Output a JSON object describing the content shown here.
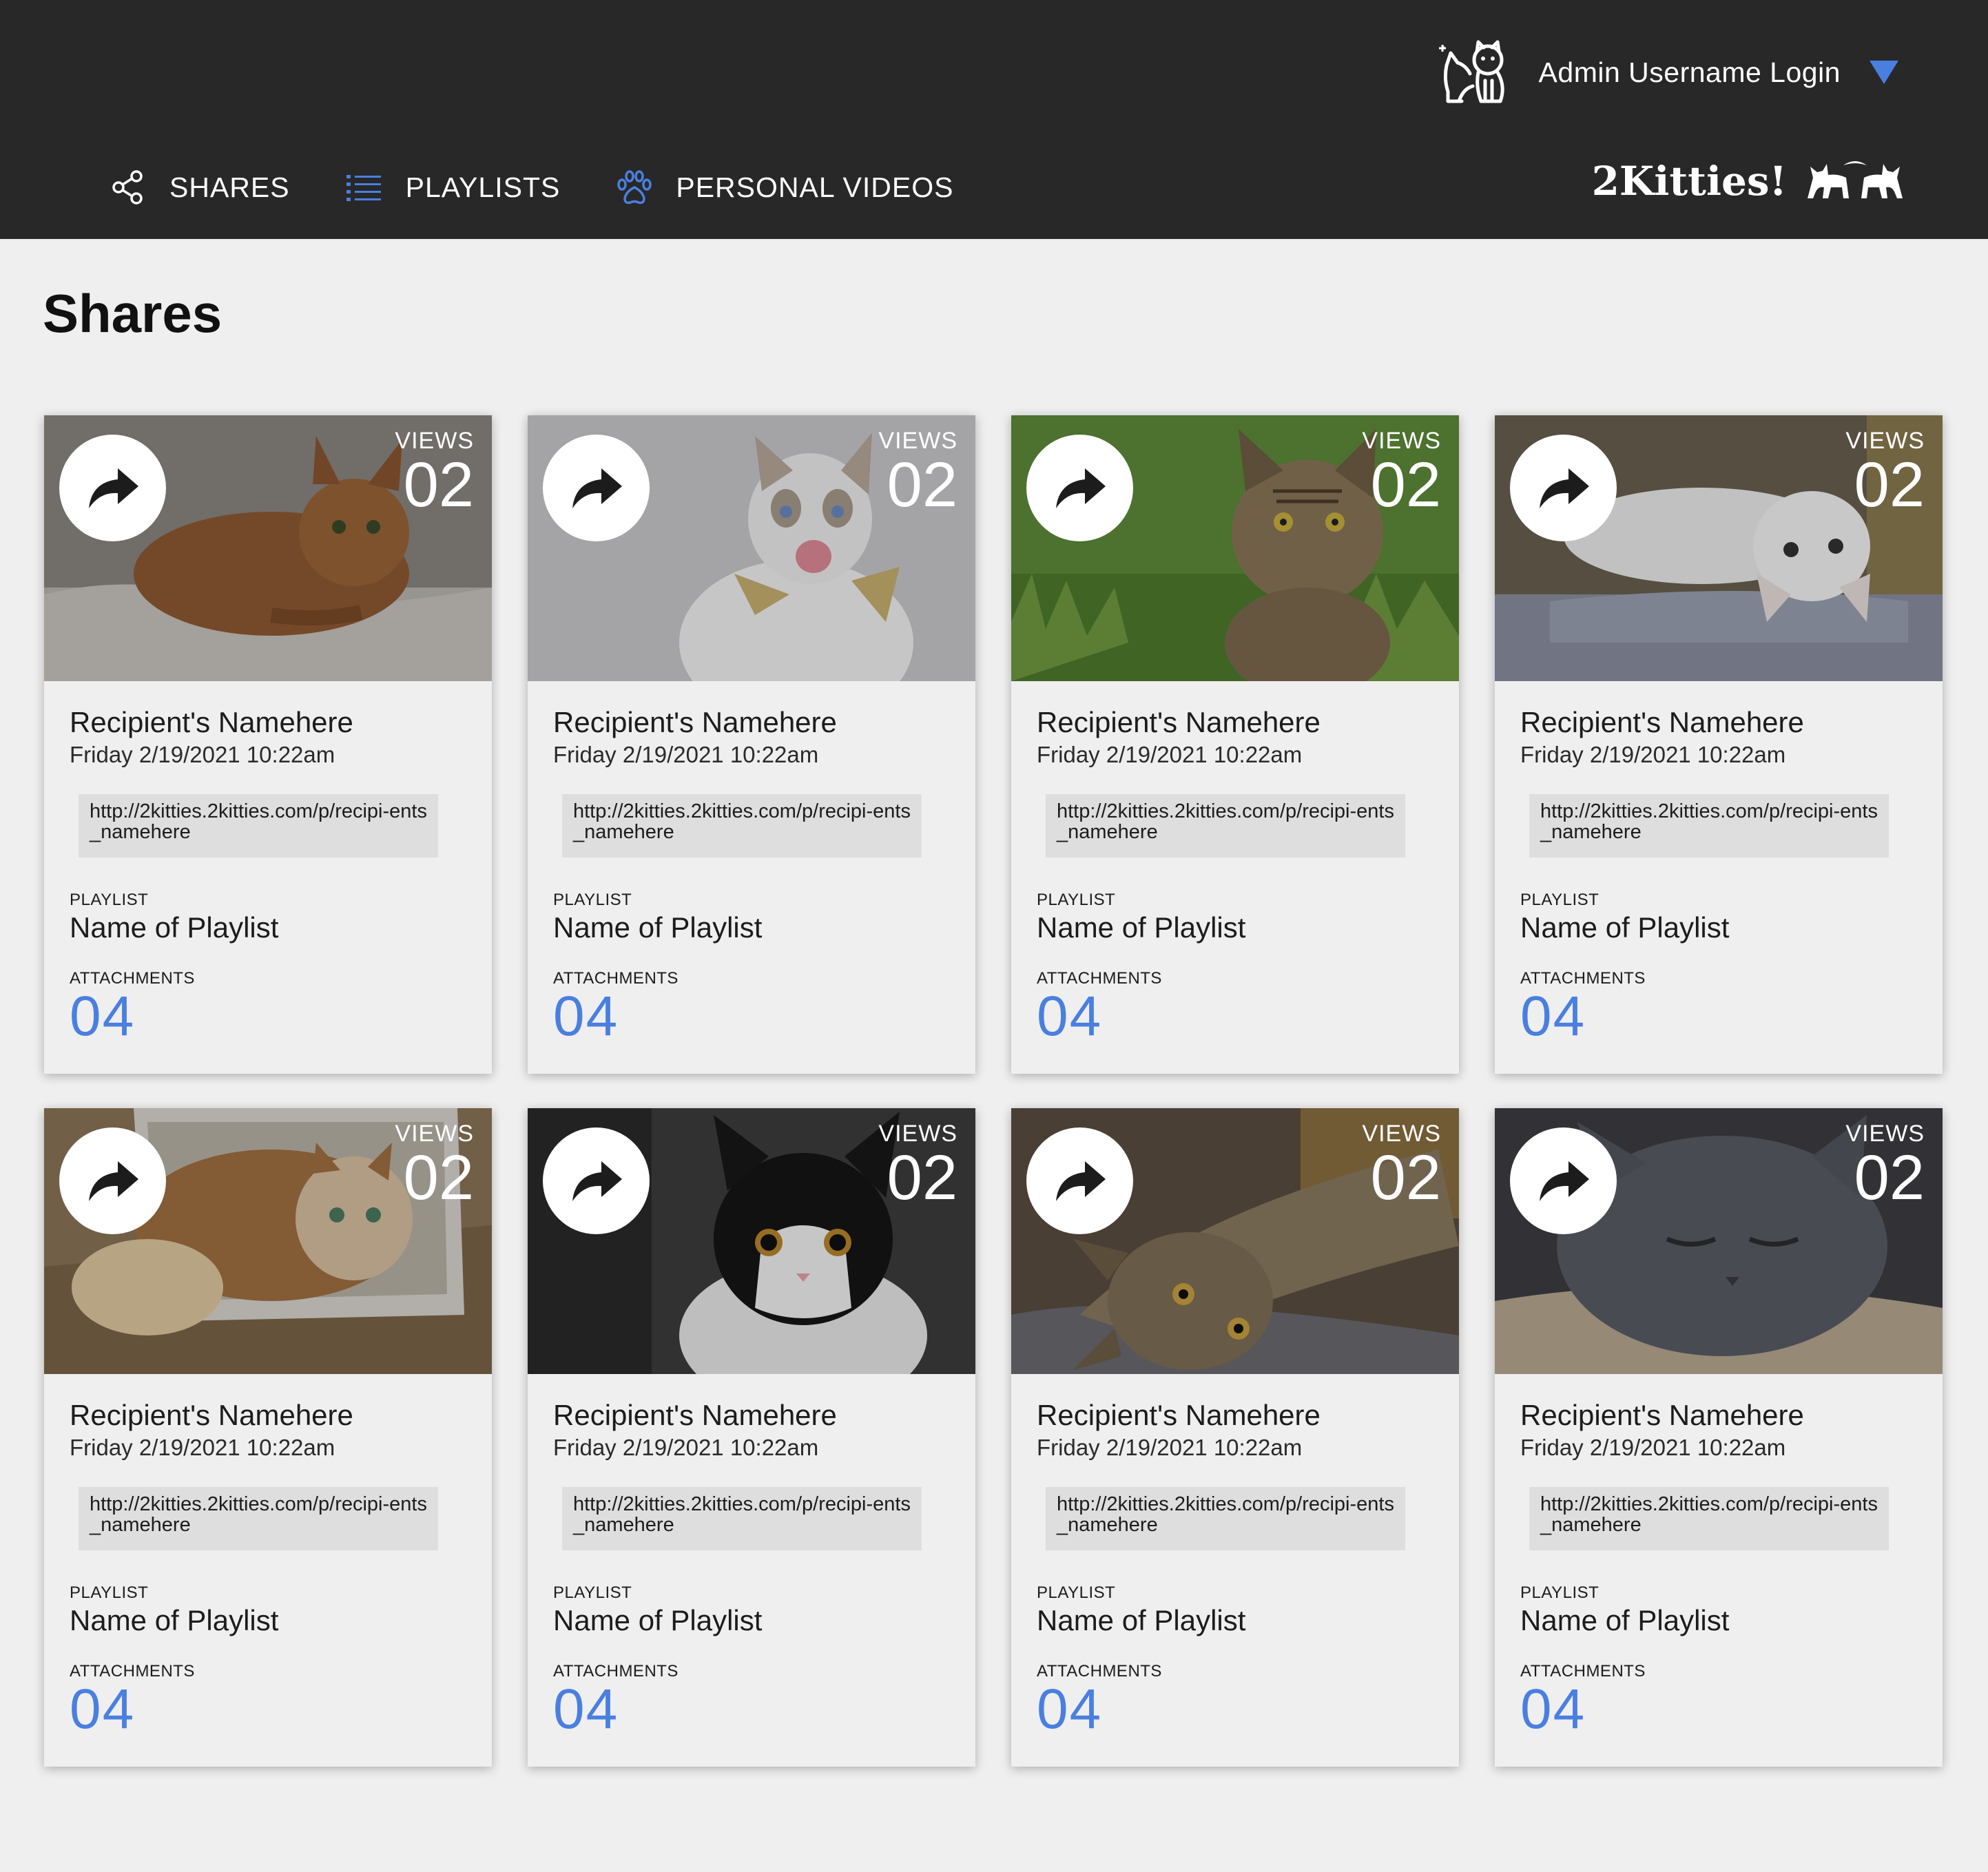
{
  "header": {
    "user_label": "Admin Username Login",
    "brand": "2Kitties!",
    "nav": [
      {
        "label": "SHARES",
        "icon": "share-icon"
      },
      {
        "label": "PLAYLISTS",
        "icon": "list-icon"
      },
      {
        "label": "PERSONAL VIDEOS",
        "icon": "paw-icon"
      }
    ],
    "accent": "#4a7fe0",
    "bar_color": "#282828"
  },
  "page": {
    "title": "Shares"
  },
  "labels": {
    "views": "VIEWS",
    "playlist": "PLAYLIST",
    "attachments": "ATTACHMENTS"
  },
  "cards": [
    {
      "views": "02",
      "recipient": "Recipient's Namehere",
      "date": "Friday 2/19/2021 10:22am",
      "url": "http://2kitties.2kitties.com/p/recipi-ents_namehere",
      "playlist": "Name of Playlist",
      "attachments": "04",
      "photo": "abyssinian-cat-on-knit-blanket"
    },
    {
      "views": "02",
      "recipient": "Recipient's Namehere",
      "date": "Friday 2/19/2021 10:22am",
      "url": "http://2kitties.2kitties.com/p/recipi-ents_namehere",
      "playlist": "Name of Playlist",
      "attachments": "04",
      "photo": "white-cat-with-bow-tie-licking"
    },
    {
      "views": "02",
      "recipient": "Recipient's Namehere",
      "date": "Friday 2/19/2021 10:22am",
      "url": "http://2kitties.2kitties.com/p/recipi-ents_namehere",
      "playlist": "Name of Playlist",
      "attachments": "04",
      "photo": "tabby-cat-in-grass"
    },
    {
      "views": "02",
      "recipient": "Recipient's Namehere",
      "date": "Friday 2/19/2021 10:22am",
      "url": "http://2kitties.2kitties.com/p/recipi-ents_namehere",
      "playlist": "Name of Playlist",
      "attachments": "04",
      "photo": "white-kitten-upside-down"
    },
    {
      "views": "02",
      "recipient": "Recipient's Namehere",
      "date": "Friday 2/19/2021 10:22am",
      "url": "http://2kitties.2kitties.com/p/recipi-ents_namehere",
      "playlist": "Name of Playlist",
      "attachments": "04",
      "photo": "fluffy-cat-in-box"
    },
    {
      "views": "02",
      "recipient": "Recipient's Namehere",
      "date": "Friday 2/19/2021 10:22am",
      "url": "http://2kitties.2kitties.com/p/recipi-ents_namehere",
      "playlist": "Name of Playlist",
      "attachments": "04",
      "photo": "black-and-white-kitten"
    },
    {
      "views": "02",
      "recipient": "Recipient's Namehere",
      "date": "Friday 2/19/2021 10:22am",
      "url": "http://2kitties.2kitties.com/p/recipi-ents_namehere",
      "playlist": "Name of Playlist",
      "attachments": "04",
      "photo": "tabby-cat-lying-sideways"
    },
    {
      "views": "02",
      "recipient": "Recipient's Namehere",
      "date": "Friday 2/19/2021 10:22am",
      "url": "http://2kitties.2kitties.com/p/recipi-ents_namehere",
      "playlist": "Name of Playlist",
      "attachments": "04",
      "photo": "grey-cat-sleeping"
    }
  ]
}
